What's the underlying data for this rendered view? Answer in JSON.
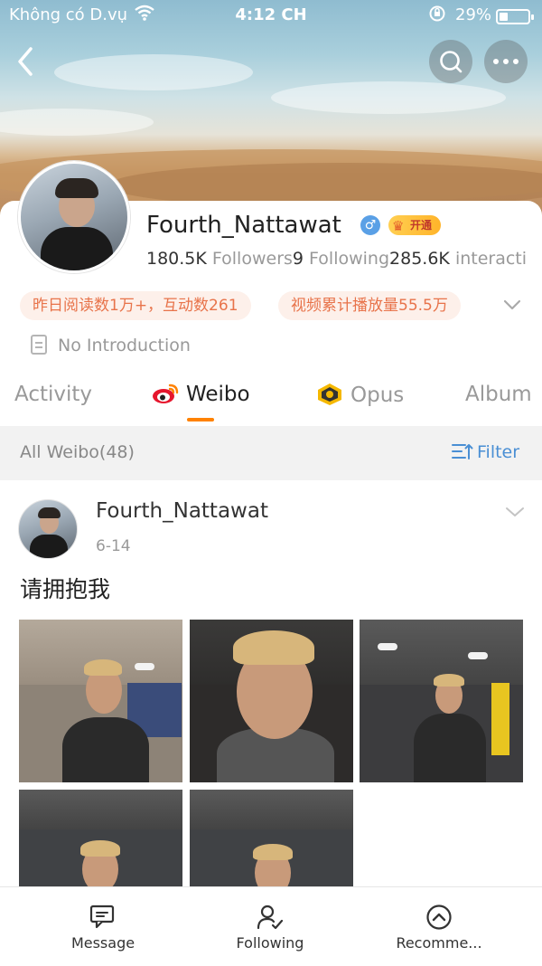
{
  "status_bar": {
    "carrier": "Không có D.vụ",
    "time": "4:12 CH",
    "battery": "29%",
    "battery_level": 0.29
  },
  "profile": {
    "name": "Fourth_Nattawat",
    "vip_label": "开通",
    "followers_count": "180.5K",
    "followers_label": "Followers",
    "following_count": "9",
    "following_label": "Following",
    "interactions_count": "285.6K",
    "interactions_label": "interacti",
    "badges": [
      "昨日阅读数1万+，互动数261",
      "视频累计播放量55.5万"
    ],
    "intro": "No Introduction"
  },
  "tabs": [
    {
      "label": "Activity",
      "active": false
    },
    {
      "label": "Weibo",
      "active": true
    },
    {
      "label": "Opus",
      "active": false
    },
    {
      "label": "Album",
      "active": false
    }
  ],
  "filter_bar": {
    "all_label": "All Weibo(48)",
    "filter_label": "Filter"
  },
  "post": {
    "author": "Fourth_Nattawat",
    "date": "6-14",
    "text": "请拥抱我",
    "photo_count": 5
  },
  "bottom_bar": {
    "items": [
      {
        "label": "Message",
        "icon": "message-icon"
      },
      {
        "label": "Following",
        "icon": "follow-user-icon"
      },
      {
        "label": "Recomme...",
        "icon": "recommend-icon"
      }
    ]
  },
  "colors": {
    "accent": "#ff8200",
    "link": "#4a8fd4",
    "badge_bg": "#fdf0ea",
    "badge_text": "#e8734a"
  }
}
